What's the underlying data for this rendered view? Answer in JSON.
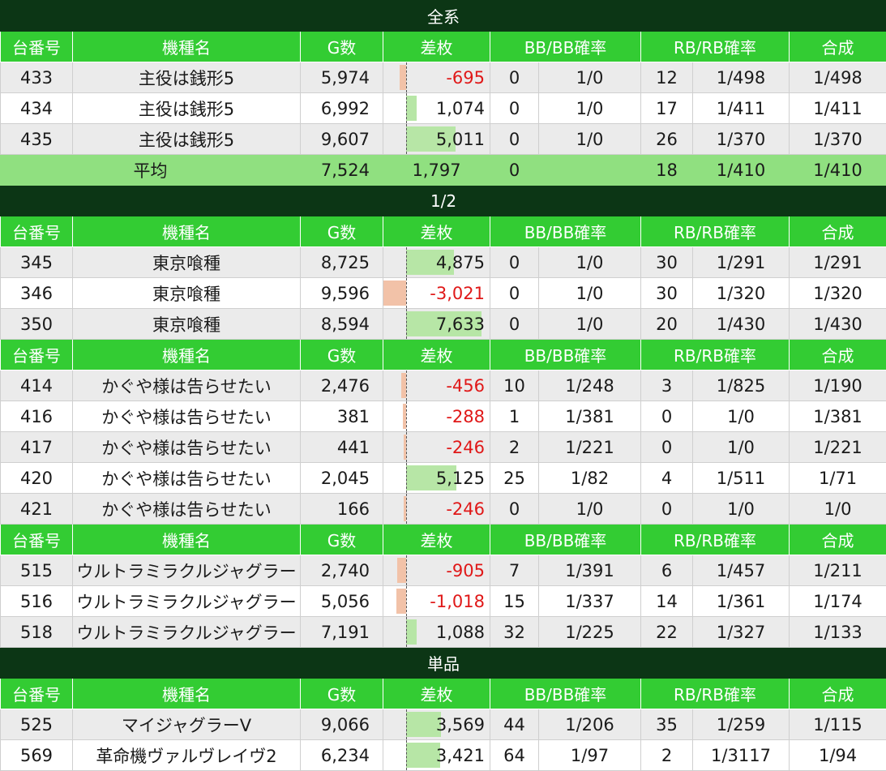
{
  "headers": {
    "unit": "台番号",
    "model": "機種名",
    "games": "G数",
    "diff": "差枚",
    "bb": "BB/BB確率",
    "rb": "RB/RB確率",
    "total": "合成"
  },
  "bar_scale_max": 7633,
  "sections": [
    {
      "title": "全系",
      "groups": [
        {
          "rows": [
            {
              "unit": "433",
              "model": "主役は銭形5",
              "games": "5,974",
              "diff": "-695",
              "diff_value": -695,
              "bb": "0",
              "bb_rate": "1/0",
              "rb": "12",
              "rb_rate": "1/498",
              "total": "1/498"
            },
            {
              "unit": "434",
              "model": "主役は銭形5",
              "games": "6,992",
              "diff": "1,074",
              "diff_value": 1074,
              "bb": "0",
              "bb_rate": "1/0",
              "rb": "17",
              "rb_rate": "1/411",
              "total": "1/411"
            },
            {
              "unit": "435",
              "model": "主役は銭形5",
              "games": "9,607",
              "diff": "5,011",
              "diff_value": 5011,
              "bb": "0",
              "bb_rate": "1/0",
              "rb": "26",
              "rb_rate": "1/370",
              "total": "1/370"
            }
          ],
          "average": {
            "label": "平均",
            "games": "7,524",
            "diff": "1,797",
            "bb": "0",
            "bb_rate": "",
            "rb": "18",
            "rb_rate": "1/410",
            "total": "1/410"
          }
        }
      ]
    },
    {
      "title": "1/2",
      "groups": [
        {
          "rows": [
            {
              "unit": "345",
              "model": "東京喰種",
              "games": "8,725",
              "diff": "4,875",
              "diff_value": 4875,
              "bb": "0",
              "bb_rate": "1/0",
              "rb": "30",
              "rb_rate": "1/291",
              "total": "1/291"
            },
            {
              "unit": "346",
              "model": "東京喰種",
              "games": "9,596",
              "diff": "-3,021",
              "diff_value": -3021,
              "bb": "0",
              "bb_rate": "1/0",
              "rb": "30",
              "rb_rate": "1/320",
              "total": "1/320"
            },
            {
              "unit": "350",
              "model": "東京喰種",
              "games": "8,594",
              "diff": "7,633",
              "diff_value": 7633,
              "bb": "0",
              "bb_rate": "1/0",
              "rb": "20",
              "rb_rate": "1/430",
              "total": "1/430"
            }
          ]
        },
        {
          "rows": [
            {
              "unit": "414",
              "model": "かぐや様は告らせたい",
              "games": "2,476",
              "diff": "-456",
              "diff_value": -456,
              "bb": "10",
              "bb_rate": "1/248",
              "rb": "3",
              "rb_rate": "1/825",
              "total": "1/190"
            },
            {
              "unit": "416",
              "model": "かぐや様は告らせたい",
              "games": "381",
              "diff": "-288",
              "diff_value": -288,
              "bb": "1",
              "bb_rate": "1/381",
              "rb": "0",
              "rb_rate": "1/0",
              "total": "1/381"
            },
            {
              "unit": "417",
              "model": "かぐや様は告らせたい",
              "games": "441",
              "diff": "-246",
              "diff_value": -246,
              "bb": "2",
              "bb_rate": "1/221",
              "rb": "0",
              "rb_rate": "1/0",
              "total": "1/221"
            },
            {
              "unit": "420",
              "model": "かぐや様は告らせたい",
              "games": "2,045",
              "diff": "5,125",
              "diff_value": 5125,
              "bb": "25",
              "bb_rate": "1/82",
              "rb": "4",
              "rb_rate": "1/511",
              "total": "1/71"
            },
            {
              "unit": "421",
              "model": "かぐや様は告らせたい",
              "games": "166",
              "diff": "-246",
              "diff_value": -246,
              "bb": "0",
              "bb_rate": "1/0",
              "rb": "0",
              "rb_rate": "1/0",
              "total": "1/0"
            }
          ]
        },
        {
          "rows": [
            {
              "unit": "515",
              "model": "ウルトラミラクルジャグラー",
              "games": "2,740",
              "diff": "-905",
              "diff_value": -905,
              "bb": "7",
              "bb_rate": "1/391",
              "rb": "6",
              "rb_rate": "1/457",
              "total": "1/211"
            },
            {
              "unit": "516",
              "model": "ウルトラミラクルジャグラー",
              "games": "5,056",
              "diff": "-1,018",
              "diff_value": -1018,
              "bb": "15",
              "bb_rate": "1/337",
              "rb": "14",
              "rb_rate": "1/361",
              "total": "1/174"
            },
            {
              "unit": "518",
              "model": "ウルトラミラクルジャグラー",
              "games": "7,191",
              "diff": "1,088",
              "diff_value": 1088,
              "bb": "32",
              "bb_rate": "1/225",
              "rb": "22",
              "rb_rate": "1/327",
              "total": "1/133"
            }
          ]
        }
      ]
    },
    {
      "title": "単品",
      "groups": [
        {
          "rows": [
            {
              "unit": "525",
              "model": "マイジャグラーV",
              "games": "9,066",
              "diff": "3,569",
              "diff_value": 3569,
              "bb": "44",
              "bb_rate": "1/206",
              "rb": "35",
              "rb_rate": "1/259",
              "total": "1/115"
            },
            {
              "unit": "569",
              "model": "革命機ヴァルヴレイヴ2",
              "games": "6,234",
              "diff": "3,421",
              "diff_value": 3421,
              "bb": "64",
              "bb_rate": "1/97",
              "rb": "2",
              "rb_rate": "1/3117",
              "total": "1/94"
            }
          ]
        }
      ]
    }
  ]
}
